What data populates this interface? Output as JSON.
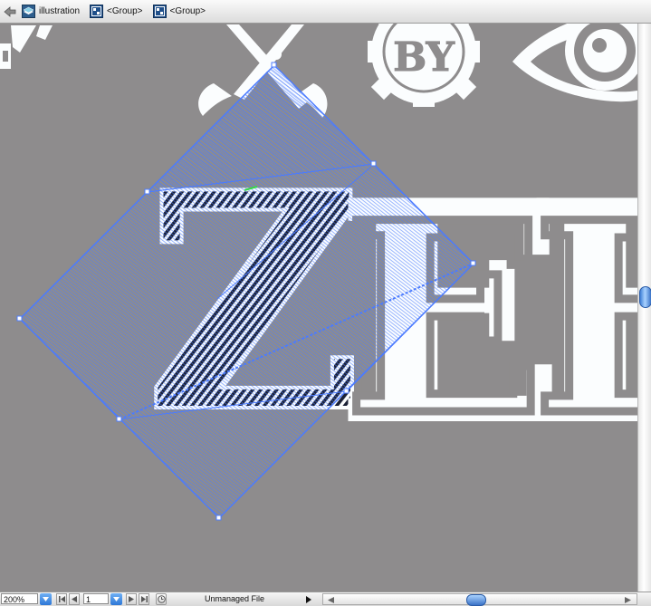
{
  "breadcrumb": {
    "items": [
      {
        "label": "illustration",
        "icon": "layer-icon"
      },
      {
        "label": "<Group>",
        "icon": "group-icon"
      },
      {
        "label": "<Group>",
        "icon": "group-icon"
      }
    ]
  },
  "canvas": {
    "letters": [
      "Z",
      "E",
      "E"
    ],
    "badge_text": "BY"
  },
  "status": {
    "zoom": "200%",
    "page": "1",
    "status_text": "Unmanaged File"
  },
  "colors": {
    "selection": "#4b7bff",
    "canvas_bg": "#8e8c8d",
    "art_white": "#fbfdfe",
    "stripe_dark": "#1a2035"
  }
}
